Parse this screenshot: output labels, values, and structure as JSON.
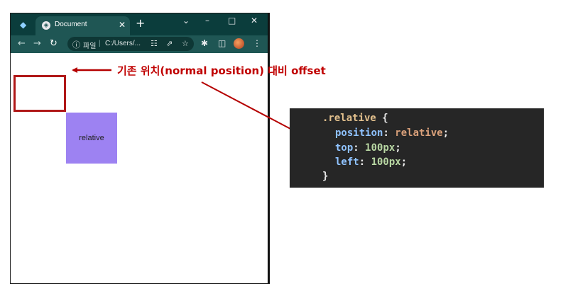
{
  "browser": {
    "tab": {
      "title": "Document"
    },
    "address": {
      "label": "파일",
      "url": "C:/Users/..."
    },
    "icons": {
      "app": "browser-app-icon",
      "favicon": "globe-icon",
      "tab_close": "close-icon",
      "new_tab": "plus-icon",
      "back": "back-arrow-icon",
      "forward": "forward-arrow-icon",
      "reload": "reload-icon",
      "info": "info-icon",
      "translate": "translate-icon",
      "share": "share-icon",
      "bookmark": "star-icon",
      "extensions": "puzzle-icon",
      "sidepanel": "sidepanel-icon",
      "menu": "kebab-menu-icon"
    }
  },
  "page": {
    "box_label": "relative"
  },
  "annotation": {
    "text": "기존 위치(normal position) 대비 offset",
    "color": "#c00000"
  },
  "code": {
    "selector": ".relative",
    "open": "{",
    "close": "}",
    "lines": [
      {
        "prop": "position",
        "value": "relative"
      },
      {
        "prop": "top",
        "value": "100px"
      },
      {
        "prop": "left",
        "value": "100px"
      }
    ]
  },
  "colors": {
    "box_fill": "#9d82f2",
    "outline": "#b01818",
    "titlebar": "#0b3d3c",
    "toolbar": "#1f5654",
    "code_bg": "#262626"
  }
}
